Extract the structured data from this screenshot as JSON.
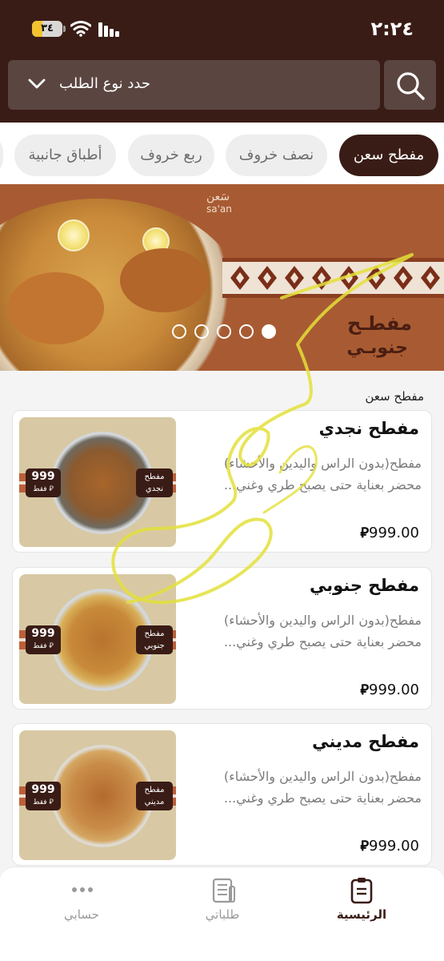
{
  "status_bar": {
    "time": "٢:٢٤",
    "battery": "٣٤",
    "battery_fraction": 0.34
  },
  "header": {
    "order_type_placeholder": "حدد نوع الطلب",
    "search_icon": "search-icon",
    "chevron_icon": "chevron-down-icon"
  },
  "categories": [
    {
      "label": "مفطح سعن",
      "active": true
    },
    {
      "label": "نصف خروف",
      "active": false
    },
    {
      "label": "ربع خروف",
      "active": false
    },
    {
      "label": "أطباق جانبية",
      "active": false
    }
  ],
  "banner": {
    "brand_ar": "سَعن",
    "brand_en": "sa'an",
    "title_line1": "مفطـح",
    "title_line2": "جنوبـي",
    "slides": 5,
    "active_slide": 5
  },
  "section_title": "مفطح سعن",
  "products": [
    {
      "title": "مفطح نجدي",
      "desc_line1": "مفطح(بدون الراس واليدين والأحشاء)",
      "desc_line2": "محضر بعناية حتى يصبح طري وغني...",
      "price": "999.00",
      "currency_symbol": "⃁",
      "image_badge_price": "999",
      "image_badge_sub": "فقط ⃁",
      "image_badge_name": "مفطح نجدي"
    },
    {
      "title": "مفطح جنوبي",
      "desc_line1": "مفطح(بدون الراس واليدين والأحشاء)",
      "desc_line2": "محضر بعناية حتى يصبح طري وغني...",
      "price": "999.00",
      "currency_symbol": "⃁",
      "image_badge_price": "999",
      "image_badge_sub": "فقط ⃁",
      "image_badge_name": "مفطح جنوبي"
    },
    {
      "title": "مفطح مديني",
      "desc_line1": "مفطح(بدون الراس واليدين والأحشاء)",
      "desc_line2": "محضر بعناية حتى يصبح طري وغني...",
      "price": "999.00",
      "currency_symbol": "⃁",
      "image_badge_price": "999",
      "image_badge_sub": "فقط ⃁",
      "image_badge_name": "مفطح مديني"
    }
  ],
  "bottom_nav": [
    {
      "label": "الرئيسية",
      "icon": "home-clipboard-icon",
      "active": true
    },
    {
      "label": "طلباتي",
      "icon": "orders-icon",
      "active": false
    },
    {
      "label": "حسابي",
      "icon": "more-dots-icon",
      "active": false
    }
  ],
  "colors": {
    "brand_dark": "#3a1c16",
    "header_field": "#5a4541",
    "banner_bg": "#a85b32",
    "scribble": "#e3e03a"
  }
}
